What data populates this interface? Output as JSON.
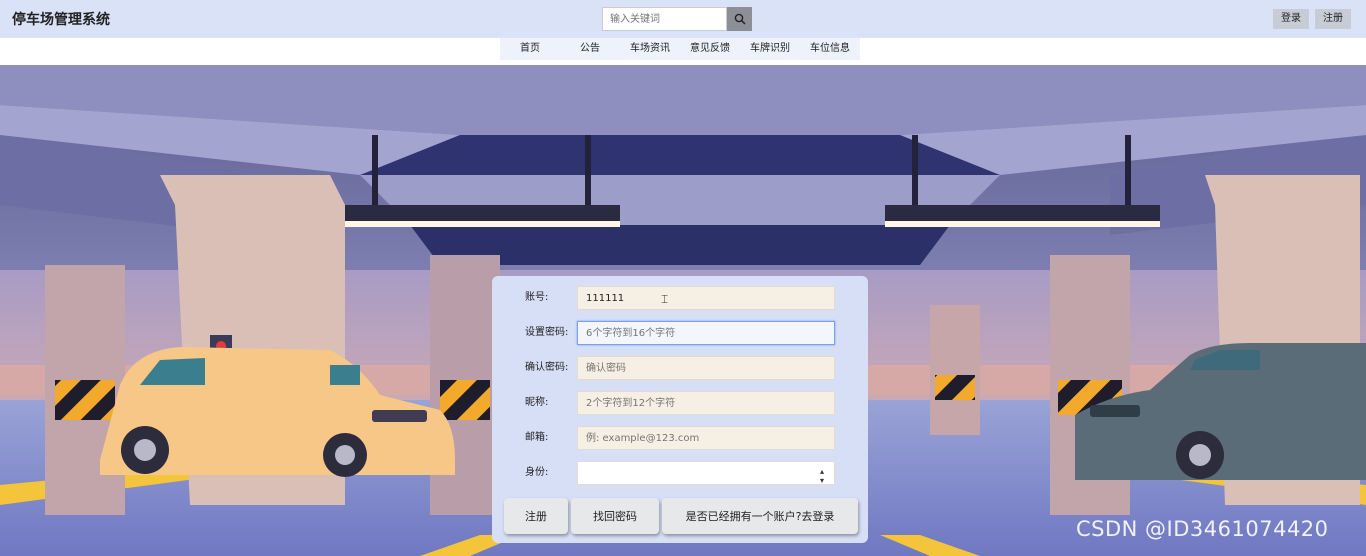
{
  "header": {
    "title": "停车场管理系统",
    "search_placeholder": "输入关键词",
    "login_label": "登录",
    "register_label": "注册"
  },
  "nav": {
    "items": [
      "首页",
      "公告",
      "车场资讯",
      "意见反馈",
      "车牌识别",
      "车位信息"
    ]
  },
  "form": {
    "account_label": "账号:",
    "account_value": "111111",
    "password_label": "设置密码:",
    "password_placeholder": "6个字符到16个字符",
    "confirm_label": "确认密码:",
    "confirm_placeholder": "确认密码",
    "nickname_label": "昵称:",
    "nickname_placeholder": "2个字符到12个字符",
    "email_label": "邮箱:",
    "email_placeholder": "例: example@123.com",
    "identity_label": "身份:",
    "identity_value": "",
    "register_button": "注册",
    "recover_button": "找回密码",
    "login_link_button": "是否已经拥有一个账户?去登录"
  },
  "watermark": "CSDN @ID3461074420",
  "colors": {
    "header_bg": "#d9e2f7",
    "form_bg": "#d7dff7",
    "field_bg": "#f6efe4"
  }
}
